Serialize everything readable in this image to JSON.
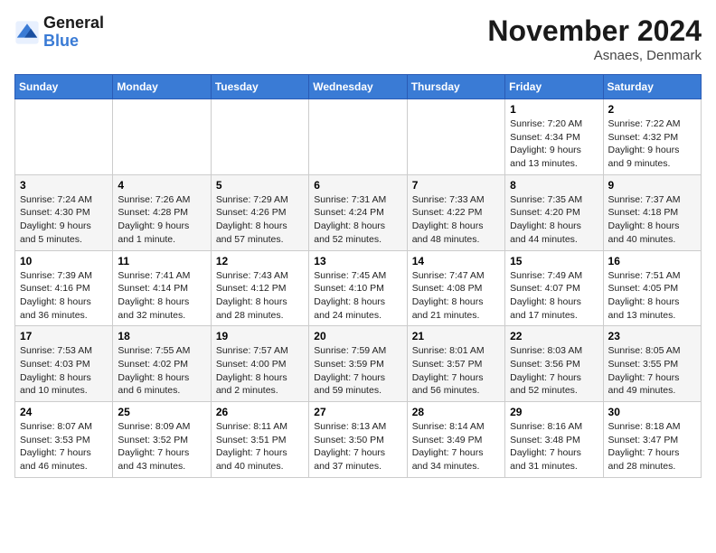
{
  "logo": {
    "text_general": "General",
    "text_blue": "Blue"
  },
  "title": "November 2024",
  "location": "Asnaes, Denmark",
  "days_of_week": [
    "Sunday",
    "Monday",
    "Tuesday",
    "Wednesday",
    "Thursday",
    "Friday",
    "Saturday"
  ],
  "weeks": [
    [
      {
        "day": "",
        "info": ""
      },
      {
        "day": "",
        "info": ""
      },
      {
        "day": "",
        "info": ""
      },
      {
        "day": "",
        "info": ""
      },
      {
        "day": "",
        "info": ""
      },
      {
        "day": "1",
        "info": "Sunrise: 7:20 AM\nSunset: 4:34 PM\nDaylight: 9 hours and 13 minutes."
      },
      {
        "day": "2",
        "info": "Sunrise: 7:22 AM\nSunset: 4:32 PM\nDaylight: 9 hours and 9 minutes."
      }
    ],
    [
      {
        "day": "3",
        "info": "Sunrise: 7:24 AM\nSunset: 4:30 PM\nDaylight: 9 hours and 5 minutes."
      },
      {
        "day": "4",
        "info": "Sunrise: 7:26 AM\nSunset: 4:28 PM\nDaylight: 9 hours and 1 minute."
      },
      {
        "day": "5",
        "info": "Sunrise: 7:29 AM\nSunset: 4:26 PM\nDaylight: 8 hours and 57 minutes."
      },
      {
        "day": "6",
        "info": "Sunrise: 7:31 AM\nSunset: 4:24 PM\nDaylight: 8 hours and 52 minutes."
      },
      {
        "day": "7",
        "info": "Sunrise: 7:33 AM\nSunset: 4:22 PM\nDaylight: 8 hours and 48 minutes."
      },
      {
        "day": "8",
        "info": "Sunrise: 7:35 AM\nSunset: 4:20 PM\nDaylight: 8 hours and 44 minutes."
      },
      {
        "day": "9",
        "info": "Sunrise: 7:37 AM\nSunset: 4:18 PM\nDaylight: 8 hours and 40 minutes."
      }
    ],
    [
      {
        "day": "10",
        "info": "Sunrise: 7:39 AM\nSunset: 4:16 PM\nDaylight: 8 hours and 36 minutes."
      },
      {
        "day": "11",
        "info": "Sunrise: 7:41 AM\nSunset: 4:14 PM\nDaylight: 8 hours and 32 minutes."
      },
      {
        "day": "12",
        "info": "Sunrise: 7:43 AM\nSunset: 4:12 PM\nDaylight: 8 hours and 28 minutes."
      },
      {
        "day": "13",
        "info": "Sunrise: 7:45 AM\nSunset: 4:10 PM\nDaylight: 8 hours and 24 minutes."
      },
      {
        "day": "14",
        "info": "Sunrise: 7:47 AM\nSunset: 4:08 PM\nDaylight: 8 hours and 21 minutes."
      },
      {
        "day": "15",
        "info": "Sunrise: 7:49 AM\nSunset: 4:07 PM\nDaylight: 8 hours and 17 minutes."
      },
      {
        "day": "16",
        "info": "Sunrise: 7:51 AM\nSunset: 4:05 PM\nDaylight: 8 hours and 13 minutes."
      }
    ],
    [
      {
        "day": "17",
        "info": "Sunrise: 7:53 AM\nSunset: 4:03 PM\nDaylight: 8 hours and 10 minutes."
      },
      {
        "day": "18",
        "info": "Sunrise: 7:55 AM\nSunset: 4:02 PM\nDaylight: 8 hours and 6 minutes."
      },
      {
        "day": "19",
        "info": "Sunrise: 7:57 AM\nSunset: 4:00 PM\nDaylight: 8 hours and 2 minutes."
      },
      {
        "day": "20",
        "info": "Sunrise: 7:59 AM\nSunset: 3:59 PM\nDaylight: 7 hours and 59 minutes."
      },
      {
        "day": "21",
        "info": "Sunrise: 8:01 AM\nSunset: 3:57 PM\nDaylight: 7 hours and 56 minutes."
      },
      {
        "day": "22",
        "info": "Sunrise: 8:03 AM\nSunset: 3:56 PM\nDaylight: 7 hours and 52 minutes."
      },
      {
        "day": "23",
        "info": "Sunrise: 8:05 AM\nSunset: 3:55 PM\nDaylight: 7 hours and 49 minutes."
      }
    ],
    [
      {
        "day": "24",
        "info": "Sunrise: 8:07 AM\nSunset: 3:53 PM\nDaylight: 7 hours and 46 minutes."
      },
      {
        "day": "25",
        "info": "Sunrise: 8:09 AM\nSunset: 3:52 PM\nDaylight: 7 hours and 43 minutes."
      },
      {
        "day": "26",
        "info": "Sunrise: 8:11 AM\nSunset: 3:51 PM\nDaylight: 7 hours and 40 minutes."
      },
      {
        "day": "27",
        "info": "Sunrise: 8:13 AM\nSunset: 3:50 PM\nDaylight: 7 hours and 37 minutes."
      },
      {
        "day": "28",
        "info": "Sunrise: 8:14 AM\nSunset: 3:49 PM\nDaylight: 7 hours and 34 minutes."
      },
      {
        "day": "29",
        "info": "Sunrise: 8:16 AM\nSunset: 3:48 PM\nDaylight: 7 hours and 31 minutes."
      },
      {
        "day": "30",
        "info": "Sunrise: 8:18 AM\nSunset: 3:47 PM\nDaylight: 7 hours and 28 minutes."
      }
    ]
  ]
}
